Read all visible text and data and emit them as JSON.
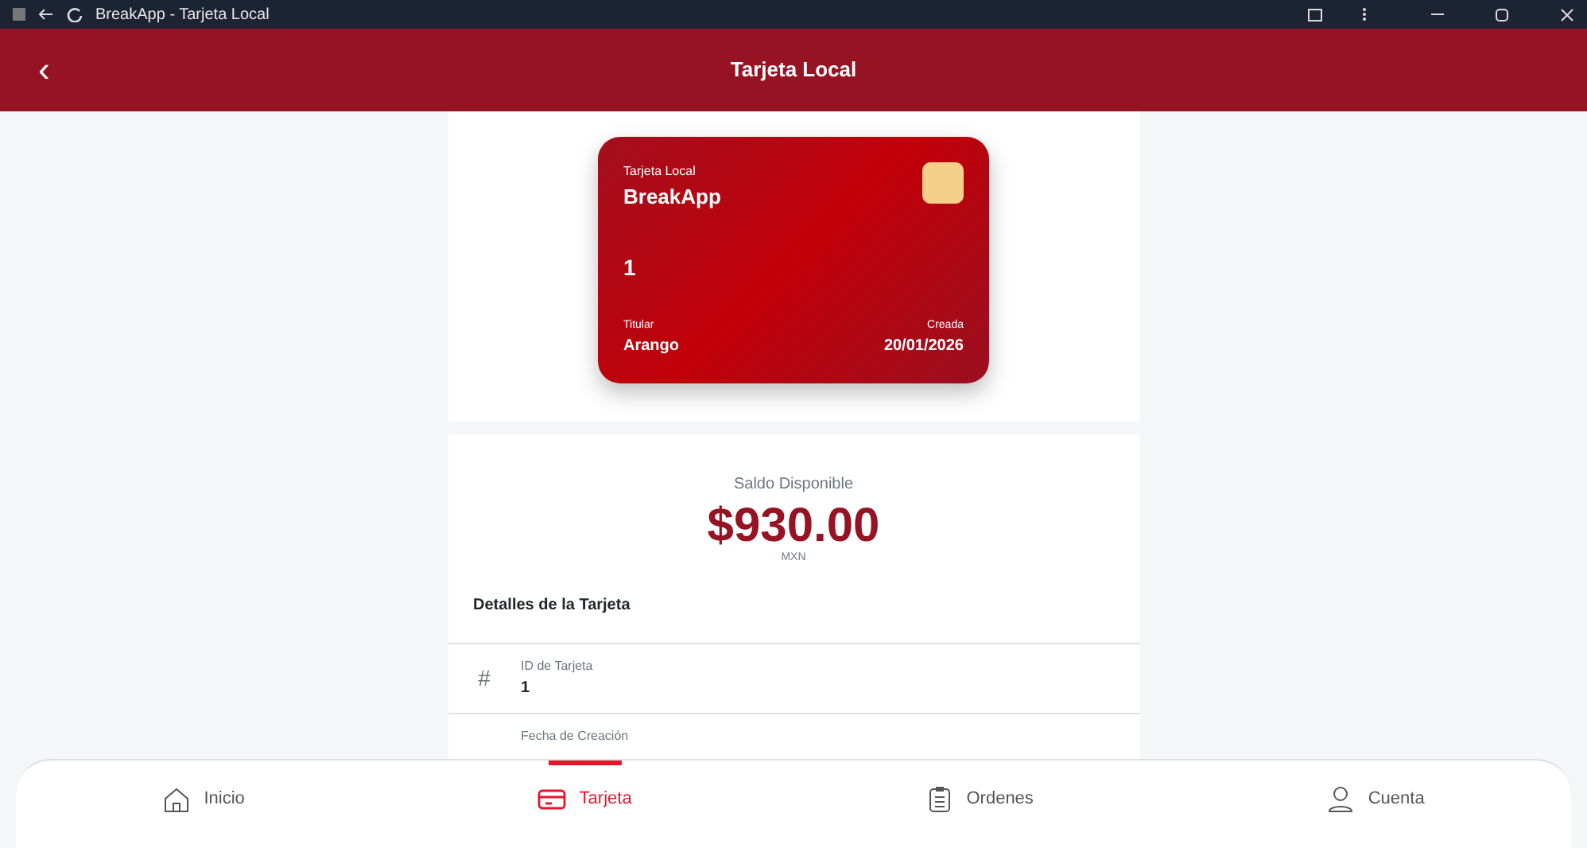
{
  "window": {
    "title": "BreakApp - Tarjeta Local"
  },
  "header": {
    "back": "‹",
    "title": "Tarjeta Local"
  },
  "card": {
    "label": "Tarjeta Local",
    "brand": "BreakApp",
    "number": "1",
    "holder_label": "Titular",
    "holder": "Arango",
    "created_label": "Creada",
    "created": "20/01/2026"
  },
  "balance": {
    "label": "Saldo Disponible",
    "amount": "$930.00",
    "currency": "MXN"
  },
  "details": {
    "title": "Detalles de la Tarjeta",
    "rows": [
      {
        "icon": "#",
        "label": "ID de Tarjeta",
        "value": "1"
      },
      {
        "label": "Fecha de Creación"
      }
    ]
  },
  "nav": [
    {
      "label": "Inicio",
      "kind": "home",
      "selected": false
    },
    {
      "label": "Tarjeta",
      "kind": "card",
      "selected": true
    },
    {
      "label": "Ordenes",
      "kind": "clipboard",
      "selected": false
    },
    {
      "label": "Cuenta",
      "kind": "user",
      "selected": false
    }
  ]
}
